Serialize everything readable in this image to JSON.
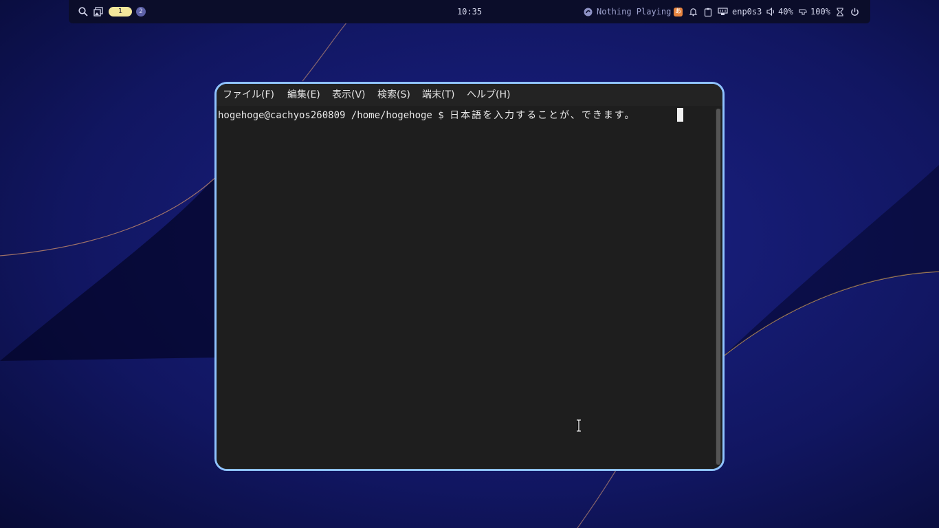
{
  "topbar": {
    "workspaces": [
      {
        "label": "1",
        "active": true
      },
      {
        "label": "2",
        "active": false
      }
    ],
    "clock": "10:35",
    "media": {
      "label": "Nothing Playing",
      "icon": "media-player-icon"
    },
    "ime": {
      "label": "あ"
    },
    "network": {
      "label": "enp0s3"
    },
    "volume": {
      "label": "40%"
    },
    "battery": {
      "label": "100%"
    },
    "colors": {
      "bar_bg": "#0b0d2a",
      "ws_active": "#f3e79b",
      "ws_inactive": "#5d61a8",
      "ime": "#e8843e"
    }
  },
  "terminal": {
    "menus": [
      {
        "label": "ファイル(F)"
      },
      {
        "label": "編集(E)"
      },
      {
        "label": "表示(V)"
      },
      {
        "label": "検索(S)"
      },
      {
        "label": "端末(T)"
      },
      {
        "label": "ヘルプ(H)"
      }
    ],
    "prompt": "hogehoge@cachyos260809 /home/hogehoge $ ",
    "input": "日本語を入力することが、できます。",
    "colors": {
      "border": "#8fc3ff",
      "background": "#1e1e1e",
      "menu_bg": "#232323"
    }
  }
}
